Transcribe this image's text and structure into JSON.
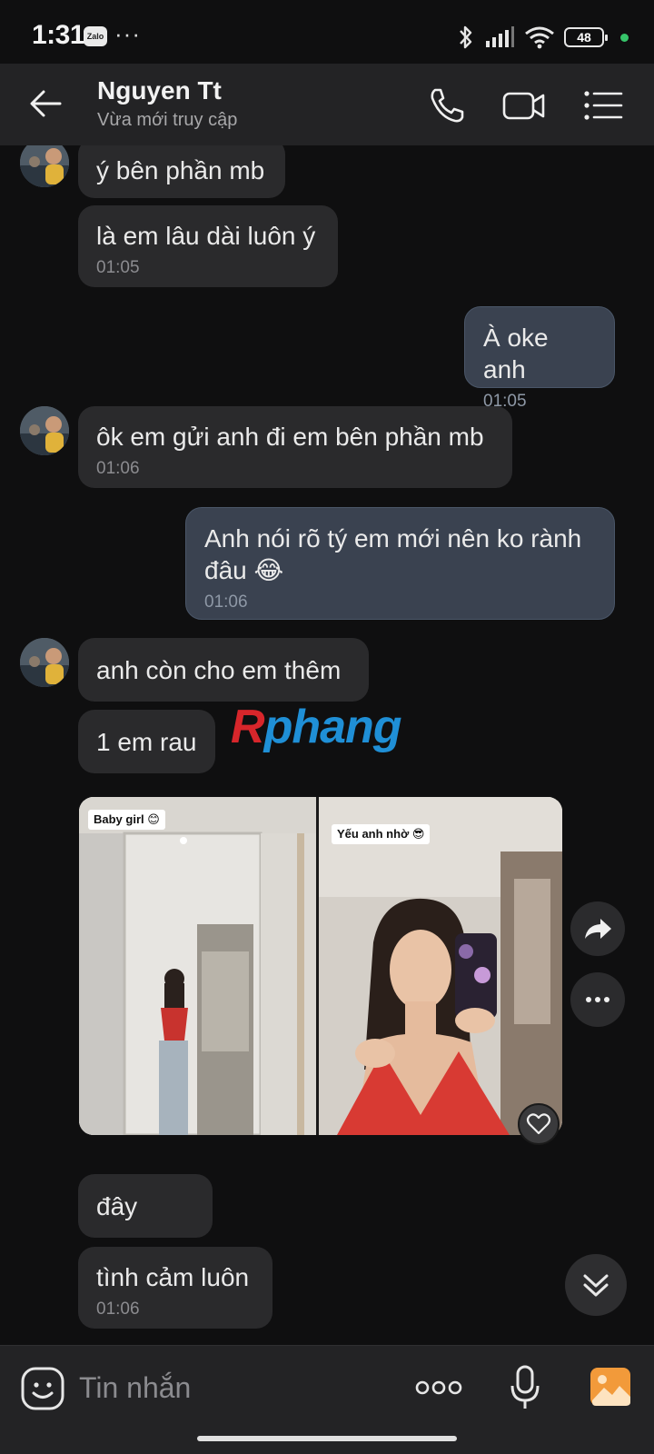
{
  "status_bar": {
    "time": "1:31",
    "app_badge": "Zalo",
    "more": "···",
    "battery": "48"
  },
  "header": {
    "name": "Nguyen Tt",
    "status": "Vừa mới truy cập"
  },
  "messages": [
    {
      "side": "them",
      "text": "ý bên phần mb",
      "time": ""
    },
    {
      "side": "them",
      "text": "là em lâu dài luôn ý",
      "time": "01:05"
    },
    {
      "side": "me",
      "text": "À oke anh",
      "time": "01:05"
    },
    {
      "side": "them",
      "text": "ôk em gửi anh đi em bên phần mb",
      "time": "01:06"
    },
    {
      "side": "me",
      "text": "Anh nói rõ tý em mới nên ko rành đâu 😂",
      "time": "01:06"
    },
    {
      "side": "them",
      "text": "anh còn cho em thêm",
      "time": ""
    },
    {
      "side": "them",
      "text": "1 em rau",
      "time": ""
    },
    {
      "side": "them",
      "text": "đây",
      "time": ""
    },
    {
      "side": "them",
      "text": "tình cảm luôn",
      "time": "01:06"
    }
  ],
  "photo": {
    "caption_left": "Baby girl 😊",
    "caption_right": "Yếu anh nhờ 😎"
  },
  "watermark": {
    "first": "R",
    "rest": "phang"
  },
  "input": {
    "placeholder": "Tin nhắn"
  },
  "colors": {
    "background": "#0f0f10",
    "bubble_them": "#2a2a2c",
    "bubble_me": "#3a4250",
    "header": "#232325"
  }
}
